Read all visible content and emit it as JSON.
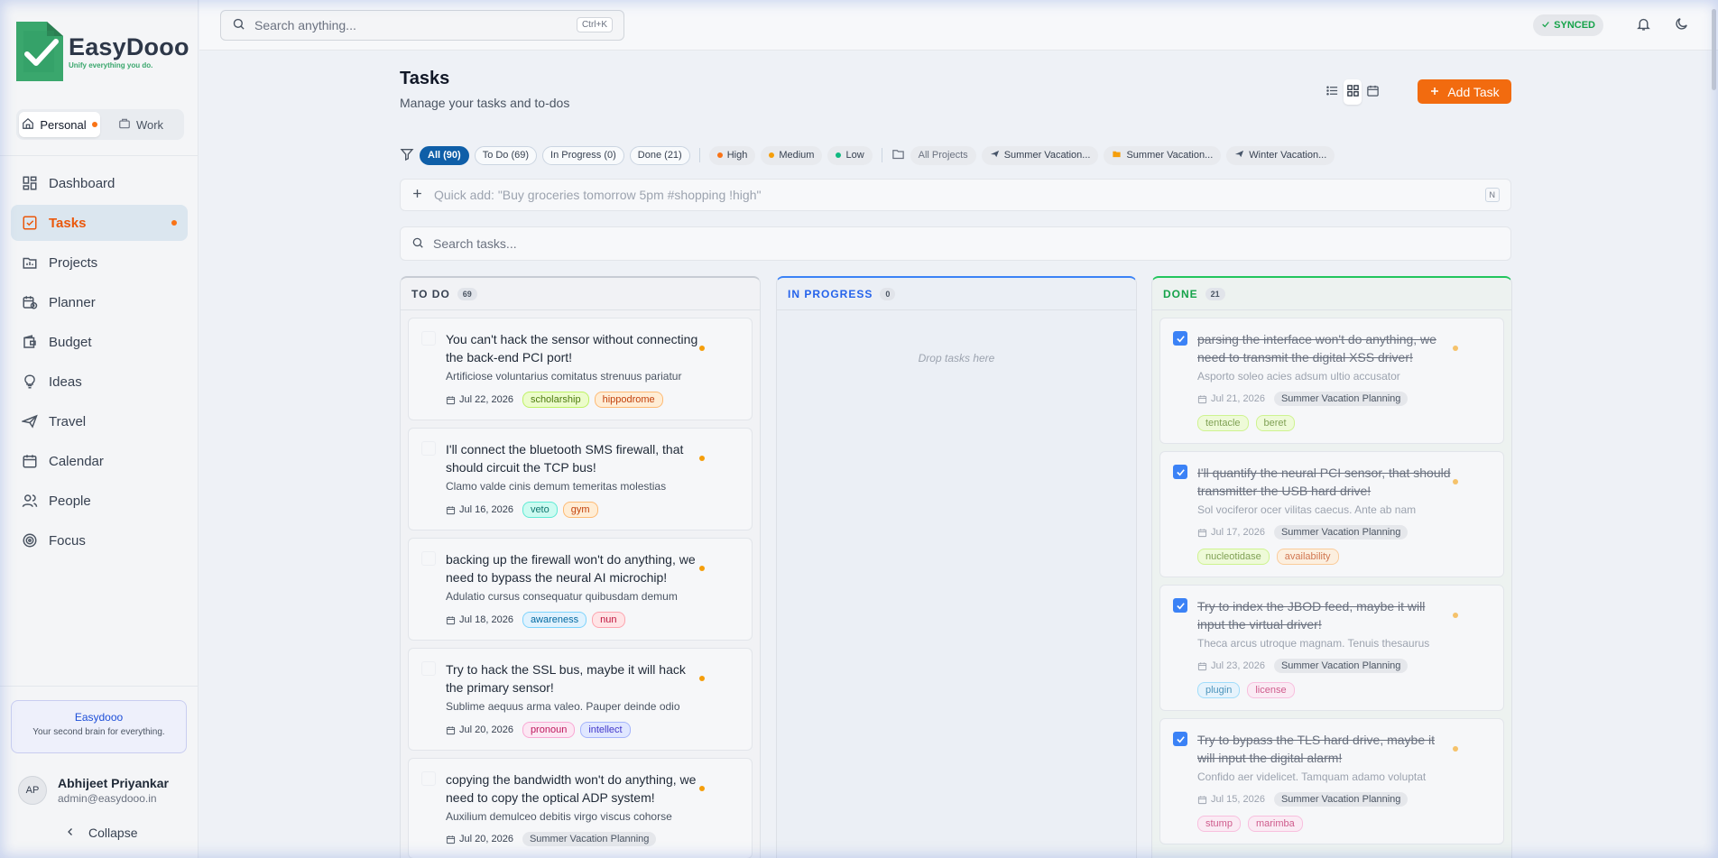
{
  "app": {
    "name": "EasyDooo",
    "tagline": "Unify everything you do."
  },
  "workspaces": [
    {
      "label": "Personal",
      "active": true
    },
    {
      "label": "Work",
      "active": false
    }
  ],
  "nav": [
    {
      "label": "Dashboard",
      "icon": "dashboard-icon"
    },
    {
      "label": "Tasks",
      "icon": "tasks-icon",
      "active": true
    },
    {
      "label": "Projects",
      "icon": "projects-icon"
    },
    {
      "label": "Planner",
      "icon": "planner-icon"
    },
    {
      "label": "Budget",
      "icon": "budget-icon"
    },
    {
      "label": "Ideas",
      "icon": "lightbulb-icon"
    },
    {
      "label": "Travel",
      "icon": "plane-icon"
    },
    {
      "label": "Calendar",
      "icon": "calendar-icon"
    },
    {
      "label": "People",
      "icon": "people-icon"
    },
    {
      "label": "Focus",
      "icon": "target-icon"
    }
  ],
  "promo": {
    "title": "Easydooo",
    "subtitle": "Your second brain for everything."
  },
  "user": {
    "initials": "AP",
    "name": "Abhijeet Priyankar",
    "email": "admin@easydooo.in"
  },
  "collapse_label": "Collapse",
  "topbar": {
    "search_placeholder": "Search anything...",
    "shortcut": "Ctrl+K",
    "sync_status": "SYNCED"
  },
  "page": {
    "title": "Tasks",
    "subtitle": "Manage your tasks and to-dos",
    "add_button": "Add Task"
  },
  "filters": {
    "status": [
      {
        "label": "All (90)",
        "active": true
      },
      {
        "label": "To Do (69)"
      },
      {
        "label": "In Progress (0)"
      },
      {
        "label": "Done (21)"
      }
    ],
    "priority": [
      {
        "label": "High",
        "color": "#f97316"
      },
      {
        "label": "Medium",
        "color": "#f59e0b"
      },
      {
        "label": "Low",
        "color": "#10b981"
      }
    ],
    "all_projects": "All Projects",
    "projects": [
      {
        "label": "Summer Vacation...",
        "icon": "plane-icon"
      },
      {
        "label": "Summer Vacation...",
        "icon": "folder-icon"
      },
      {
        "label": "Winter Vacation...",
        "icon": "plane-icon"
      }
    ]
  },
  "quick_add": {
    "placeholder": "Quick add: \"Buy groceries tomorrow 5pm #shopping !high\"",
    "shortcut": "N"
  },
  "task_search": {
    "placeholder": "Search tasks..."
  },
  "columns": {
    "todo": {
      "title": "TO DO",
      "count": "69",
      "cards": [
        {
          "title": "You can't hack the sensor without connecting the back-end PCI port!",
          "desc": "Artificiose voluntarius comitatus strenuus pariatur",
          "date": "Jul 22, 2026",
          "tags": [
            {
              "label": "scholarship",
              "cls": "t-green"
            },
            {
              "label": "hippodrome",
              "cls": "t-orange"
            }
          ]
        },
        {
          "title": "I'll connect the bluetooth SMS firewall, that should circuit the TCP bus!",
          "desc": "Clamo valde cinis demum temeritas molestias",
          "date": "Jul 16, 2026",
          "tags": [
            {
              "label": "veto",
              "cls": "t-teal"
            },
            {
              "label": "gym",
              "cls": "t-orange"
            }
          ]
        },
        {
          "title": "backing up the firewall won't do anything, we need to bypass the neural AI microchip!",
          "desc": "Adulatio cursus consequatur quibusdam demum",
          "date": "Jul 18, 2026",
          "tags": [
            {
              "label": "awareness",
              "cls": "t-sky"
            },
            {
              "label": "nun",
              "cls": "t-red"
            }
          ]
        },
        {
          "title": "Try to hack the SSL bus, maybe it will hack the primary sensor!",
          "desc": "Sublime aequus arma valeo. Pauper deinde odio",
          "date": "Jul 20, 2026",
          "tags": [
            {
              "label": "pronoun",
              "cls": "t-pink"
            },
            {
              "label": "intellect",
              "cls": "t-indigo"
            }
          ]
        },
        {
          "title": "copying the bandwidth won't do anything, we need to copy the optical ADP system!",
          "desc": "Auxilium demulceo debitis virgo viscus cohorse",
          "date": "Jul 20, 2026",
          "project": "Summer Vacation Planning",
          "tags": []
        }
      ]
    },
    "progress": {
      "title": "IN PROGRESS",
      "count": "0",
      "empty": "Drop tasks here"
    },
    "done": {
      "title": "DONE",
      "count": "21",
      "cards": [
        {
          "title": "parsing the interface won't do anything, we need to transmit the digital XSS driver!",
          "desc": "Asporto soleo acies adsum ultio accusator",
          "date": "Jul 21, 2026",
          "project": "Summer Vacation Planning",
          "tags": [
            {
              "label": "tentacle",
              "cls": "t-lime"
            },
            {
              "label": "beret",
              "cls": "t-lime"
            }
          ]
        },
        {
          "title": "I'll quantify the neural PCI sensor, that should transmitter the USB hard drive!",
          "desc": "Sol vociferor ocer vilitas caecus. Ante ab nam",
          "date": "Jul 17, 2026",
          "project": "Summer Vacation Planning",
          "tags": [
            {
              "label": "nucleotidase",
              "cls": "t-lime"
            },
            {
              "label": "availability",
              "cls": "t-orange"
            }
          ]
        },
        {
          "title": "Try to index the JBOD feed, maybe it will input the virtual driver!",
          "desc": "Theca arcus utroque magnam. Tenuis thesaurus",
          "date": "Jul 23, 2026",
          "project": "Summer Vacation Planning",
          "tags": [
            {
              "label": "plugin",
              "cls": "t-sky"
            },
            {
              "label": "license",
              "cls": "t-pink"
            }
          ]
        },
        {
          "title": "Try to bypass the TLS hard drive, maybe it will input the digital alarm!",
          "desc": "Confido aer videlicet. Tamquam adamo voluptat",
          "date": "Jul 15, 2026",
          "project": "Summer Vacation Planning",
          "tags": [
            {
              "label": "stump",
              "cls": "t-pink"
            },
            {
              "label": "marimba",
              "cls": "t-pink"
            }
          ]
        }
      ]
    }
  },
  "colors": {
    "accent": "#f26b0f",
    "primary_blue": "#0f5fa8",
    "done_green": "#22c55e",
    "progress_blue": "#3b82f6"
  }
}
